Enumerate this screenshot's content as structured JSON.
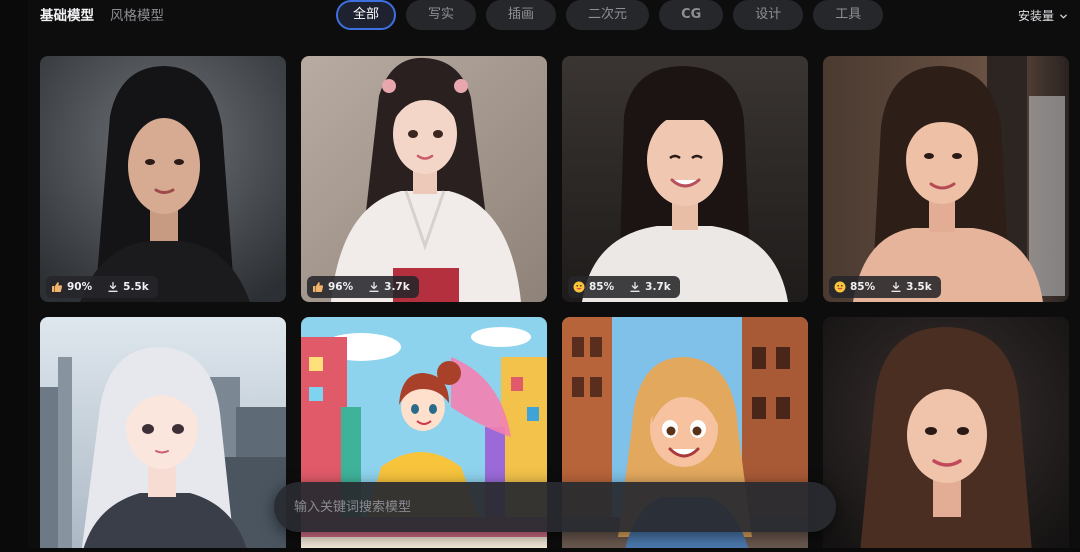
{
  "header": {
    "model_tabs": [
      "基础模型",
      "风格模型"
    ],
    "active_model_tab": 0,
    "category_chips": [
      "全部",
      "写实",
      "插画",
      "二次元",
      "CG",
      "设计",
      "工具"
    ],
    "active_chip": 0,
    "sort_label": "安装量",
    "sort_icon": "chevron-down-icon"
  },
  "cards": [
    {
      "reaction": "thumbs-up",
      "rating": "90%",
      "downloads": "5.5k"
    },
    {
      "reaction": "thumbs-up",
      "rating": "96%",
      "downloads": "3.7k"
    },
    {
      "reaction": "smile-emoji",
      "rating": "85%",
      "downloads": "3.7k"
    },
    {
      "reaction": "smile-emoji",
      "rating": "85%",
      "downloads": "3.5k"
    },
    {
      "reaction": "",
      "rating": "",
      "downloads": ""
    },
    {
      "reaction": "",
      "rating": "",
      "downloads": ""
    },
    {
      "reaction": "",
      "rating": "",
      "downloads": ""
    },
    {
      "reaction": "",
      "rating": "",
      "downloads": ""
    }
  ],
  "icons": {
    "download": "download-icon"
  },
  "search": {
    "placeholder": "输入关键词搜索模型"
  },
  "colors": {
    "background": "#0d0d0e",
    "chip_bg": "#26272b",
    "active_chip_border": "#3c6fe0",
    "stat_pill_bg": "#26262a"
  }
}
